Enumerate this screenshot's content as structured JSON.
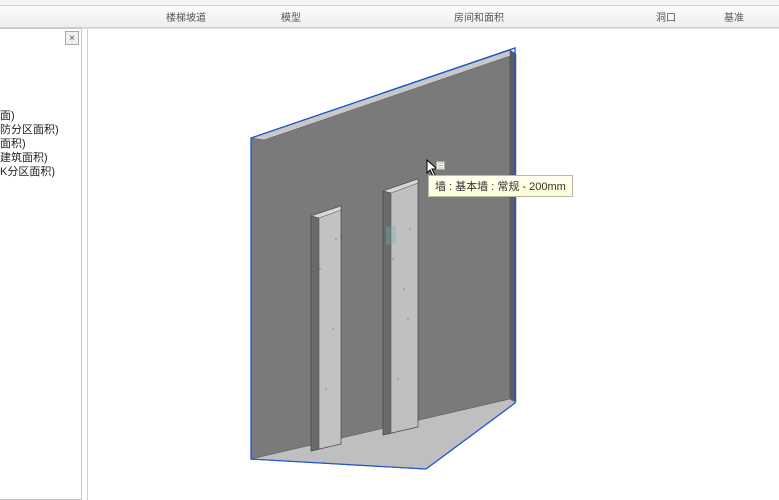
{
  "ribbon": {
    "tabs": [
      "楼梯坡道",
      "模型",
      "房间和面积",
      "洞口",
      "基准"
    ]
  },
  "side_panel": {
    "close": "×",
    "items": [
      "面)",
      "防分区面积)",
      "面积)",
      "建筑面积)",
      "K分区面积)"
    ]
  },
  "tooltip": "墙 : 基本墙 : 常规 - 200mm"
}
